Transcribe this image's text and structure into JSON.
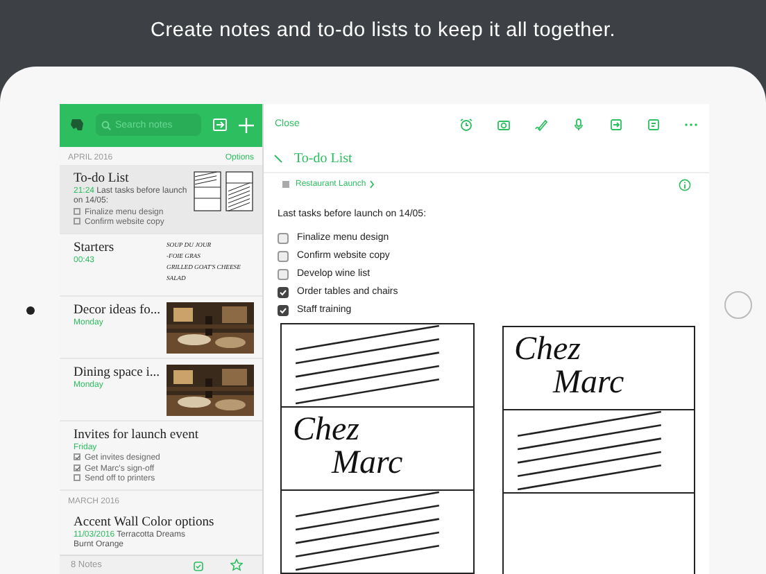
{
  "headline": "Create notes and to-do lists to keep it all together.",
  "sidebar": {
    "search": {
      "placeholder": "Search notes"
    },
    "groups": [
      {
        "label": "APRIL 2016",
        "action": "Options",
        "notes": [
          {
            "title": "To-do List",
            "selected": true,
            "time": "21:24",
            "snippet": "Last tasks before launch on 14/05:",
            "checklist": [
              {
                "text": "Finalize menu design",
                "checked": false
              },
              {
                "text": "Confirm website copy",
                "checked": false
              }
            ],
            "thumbnail": {
              "kind": "sketch"
            }
          },
          {
            "title": "Starters",
            "selected": false,
            "time": "00:43",
            "thumbnail": {
              "kind": "handwriting",
              "lines": [
                "SOUP DU JOUR",
                "-FOIE GRAS",
                "GRILLED GOAT'S CHEESE",
                "SALAD"
              ]
            }
          },
          {
            "title": "Decor ideas fo...",
            "selected": false,
            "time": "Monday"
          },
          {
            "title": "Dining space i...",
            "selected": false,
            "time": "Monday"
          },
          {
            "title": "Invites for launch event",
            "selected": false,
            "time": "Friday",
            "checklist": [
              {
                "text": "Get invites designed",
                "checked": true
              },
              {
                "text": "Get Marc's sign-off",
                "checked": true
              },
              {
                "text": "Send off to printers",
                "checked": false
              }
            ]
          }
        ]
      },
      {
        "label": "MARCH 2016",
        "notes": [
          {
            "title": "Accent Wall Color options",
            "selected": false,
            "time": "11/03/2016",
            "snippet": "Terracotta Dreams",
            "extra": "Burnt Orange"
          }
        ]
      }
    ],
    "footer": {
      "count": "8 Notes"
    }
  },
  "editor": {
    "close": "Close",
    "title": "To-do List",
    "notebook": "Restaurant Launch",
    "intro": "Last tasks before launch on 14/05:",
    "checklist": [
      {
        "text": "Finalize menu design",
        "checked": false
      },
      {
        "text": "Confirm website copy",
        "checked": false
      },
      {
        "text": "Develop wine list",
        "checked": false
      },
      {
        "text": "Order tables and chairs",
        "checked": true
      },
      {
        "text": "Staff training",
        "checked": true
      }
    ],
    "sketch": {
      "columns": [
        [
          {
            "kind": "hatch"
          },
          {
            "kind": "label",
            "words": [
              "Chez",
              "Marc"
            ]
          },
          {
            "kind": "hatch"
          }
        ],
        [
          {
            "kind": "label",
            "words": [
              "Chez",
              "Marc"
            ]
          },
          {
            "kind": "hatch"
          }
        ]
      ]
    }
  }
}
